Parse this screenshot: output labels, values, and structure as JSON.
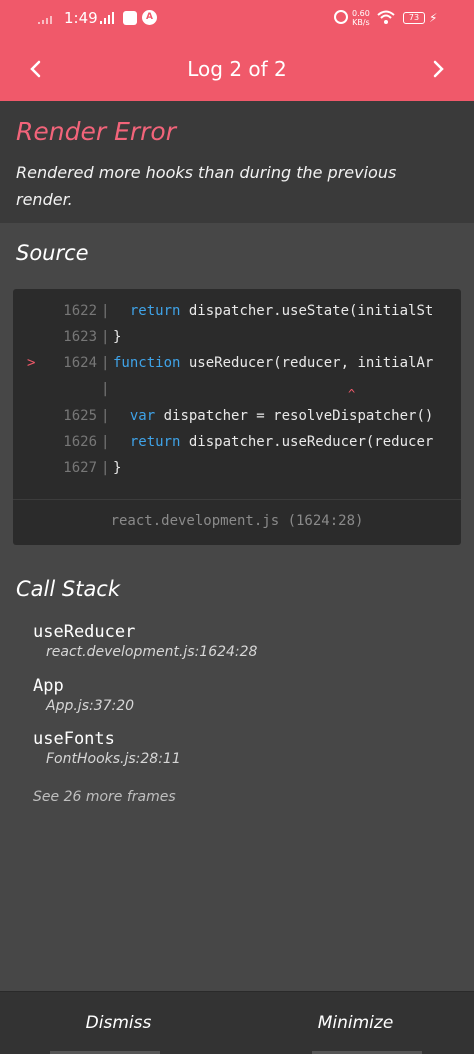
{
  "status_bar": {
    "time": "1:49",
    "net_speed_value": "0.60",
    "net_speed_unit": "KB/s",
    "battery": "73",
    "accent": "#f0596a"
  },
  "header": {
    "title": "Log 2 of 2",
    "prev_icon": "chevron-left-icon",
    "next_icon": "chevron-right-icon"
  },
  "error": {
    "title": "Render Error",
    "message": "Rendered more hooks than during the previous render."
  },
  "source": {
    "title": "Source",
    "lines": [
      {
        "num": "1622",
        "marker": "",
        "kw": "  return",
        "rest": " dispatcher.useState(initialSt"
      },
      {
        "num": "1623",
        "marker": "",
        "kw": "",
        "rest": "}"
      },
      {
        "num": "1624",
        "marker": ">",
        "kw": "function",
        "rest": " useReducer(reducer, initialAr"
      },
      {
        "num": "1625",
        "marker": "",
        "kw": "  var",
        "rest": " dispatcher = resolveDispatcher()"
      },
      {
        "num": "1626",
        "marker": "",
        "kw": "  return",
        "rest": " dispatcher.useReducer(reducer"
      },
      {
        "num": "1627",
        "marker": "",
        "kw": "",
        "rest": "}"
      }
    ],
    "caret": "^",
    "file": "react.development.js (1624:28)"
  },
  "call_stack": {
    "title": "Call Stack",
    "frames": [
      {
        "fn": "useReducer",
        "loc": "react.development.js:1624:28"
      },
      {
        "fn": "App",
        "loc": "App.js:37:20"
      },
      {
        "fn": "useFonts",
        "loc": "FontHooks.js:28:11"
      }
    ],
    "more": "See 26 more frames"
  },
  "footer": {
    "dismiss": "Dismiss",
    "minimize": "Minimize"
  }
}
